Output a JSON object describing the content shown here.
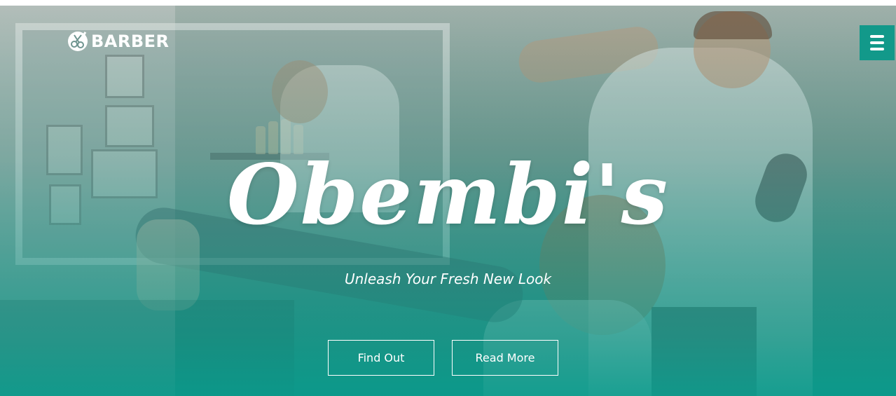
{
  "header": {
    "logo_text": "BARBER",
    "logo_icon": "scissors-comb-icon",
    "menu_icon": "hamburger-menu-icon"
  },
  "hero": {
    "title": "Obembi's",
    "tagline": "Unleash Your Fresh New Look",
    "buttons": {
      "find_out": "Find Out",
      "read_more": "Read More"
    }
  },
  "colors": {
    "accent": "#12998a",
    "text": "#ffffff"
  }
}
